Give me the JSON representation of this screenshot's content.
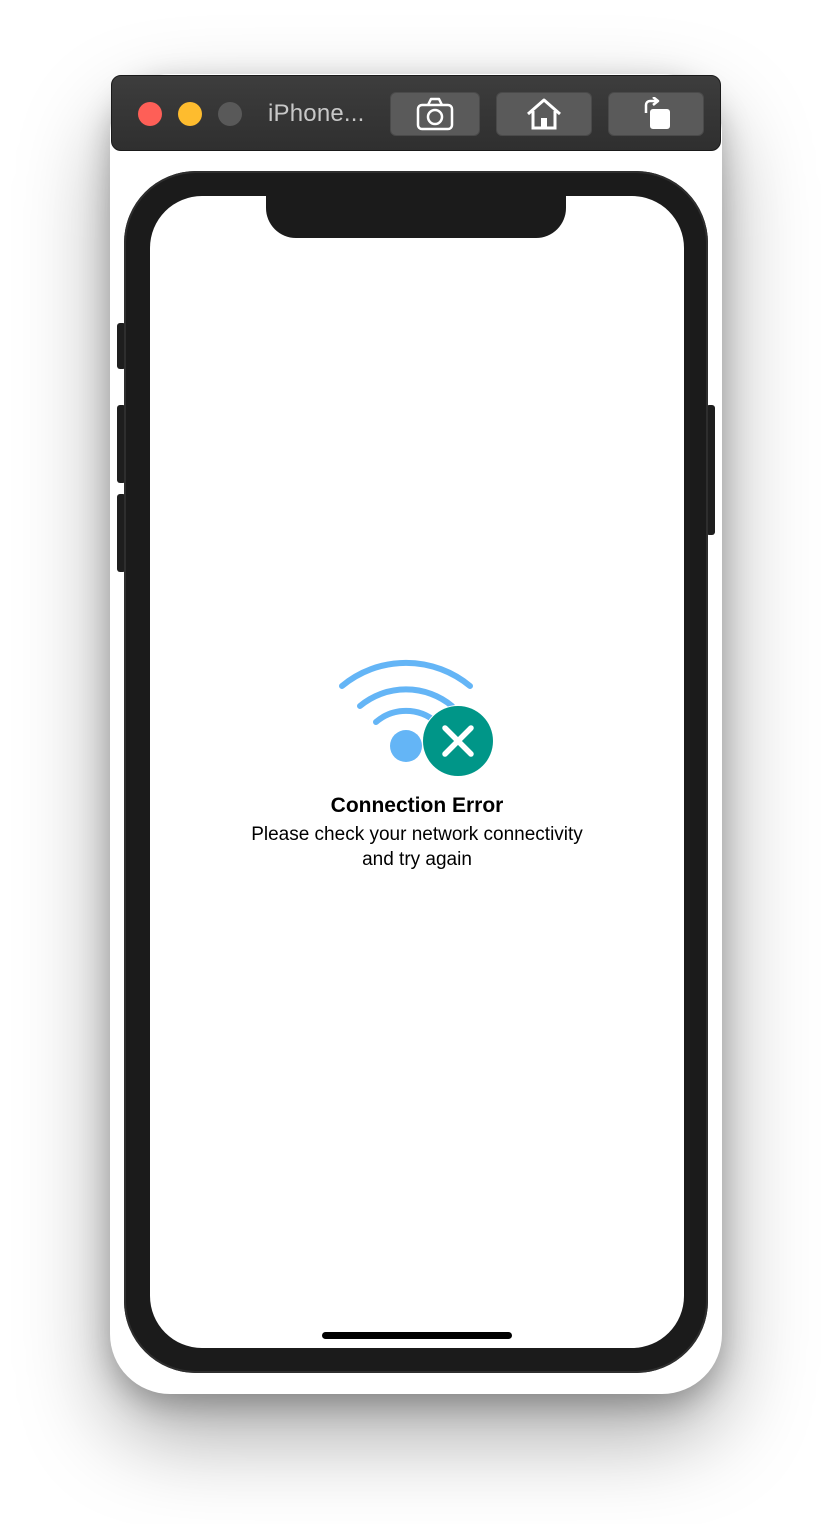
{
  "window": {
    "title": "iPhone...",
    "buttons": {
      "screenshot": "camera-icon",
      "home": "home-icon",
      "rotate": "rotate-icon"
    },
    "traffic_lights": {
      "close": "#fe5f57",
      "minimize": "#febc2e",
      "zoom": "#595959"
    }
  },
  "screen": {
    "icon": "wifi-error-icon",
    "title": "Connection Error",
    "message_line1": "Please check your network connectivity",
    "message_line2": "and try again",
    "colors": {
      "wifi": "#64b5f6",
      "error_badge": "#009688"
    }
  }
}
